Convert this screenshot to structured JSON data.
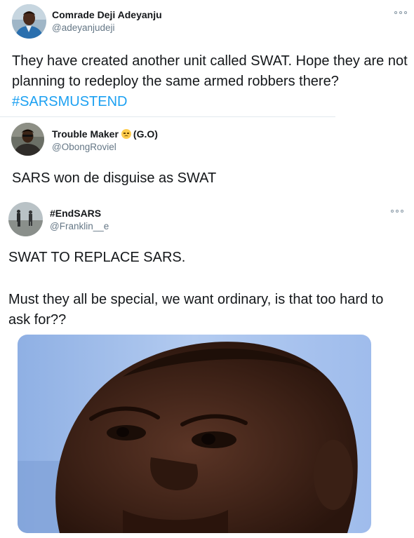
{
  "tweets": [
    {
      "name": "Comrade Deji Adeyanju",
      "handle": "@adeyanjudeji",
      "text": "They have created another unit called SWAT. Hope they are not planning to redeploy the same armed robbers there?",
      "hashtag": "#SARSMUSTEND"
    },
    {
      "name": "Trouble Maker",
      "name_suffix": "(G.O)",
      "name_emoji": "pensive-face-emoji",
      "handle": "@ObongRoviel",
      "text": "SARS won de disguise as SWAT"
    },
    {
      "name": "#EndSARS",
      "handle": "@Franklin__e",
      "text_line1": "SWAT TO REPLACE SARS.",
      "text_line2": "Must they all be special, we want ordinary, is that too hard to ask for??"
    }
  ],
  "colors": {
    "text": "#14171a",
    "secondary": "#657786",
    "link": "#1da1f2",
    "divider": "#e1e8ed"
  }
}
